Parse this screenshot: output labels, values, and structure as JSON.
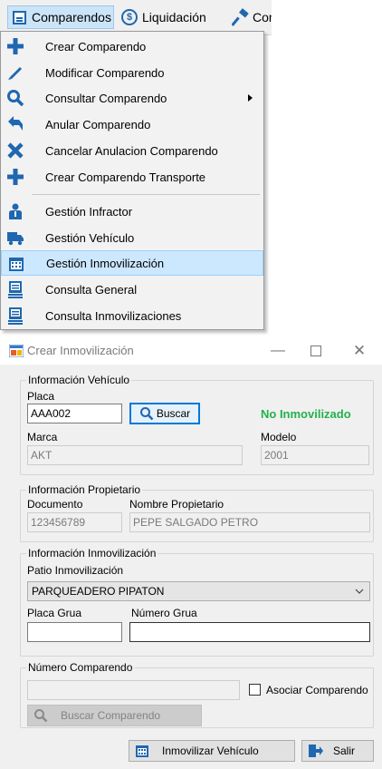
{
  "menubar": {
    "items": [
      {
        "label": "Comparendos",
        "icon": "document-list-icon"
      },
      {
        "label": "Liquidación",
        "icon": "dollar-circle-icon"
      },
      {
        "label": "Con",
        "icon": "gavel-icon"
      }
    ]
  },
  "dropdown": {
    "items": [
      {
        "label": "Crear Comparendo",
        "icon": "plus-icon"
      },
      {
        "label": "Modificar Comparendo",
        "icon": "pencil-icon"
      },
      {
        "label": "Consultar Comparendo",
        "icon": "search-icon",
        "submenu": true
      },
      {
        "label": "Anular Comparendo",
        "icon": "undo-arrow-icon"
      },
      {
        "label": "Cancelar Anulacion Comparendo",
        "icon": "x-icon"
      },
      {
        "label": "Crear Comparendo Transporte",
        "icon": "plus-icon"
      },
      {
        "label": "Gestión Infractor",
        "icon": "person-icon"
      },
      {
        "label": "Gestión Vehículo",
        "icon": "truck-icon"
      },
      {
        "label": "Gestión Inmovilización",
        "icon": "calendar-icon",
        "highlighted": true
      },
      {
        "label": "Consulta General",
        "icon": "stack-icon"
      },
      {
        "label": "Consulta Inmovilizaciones",
        "icon": "stack-icon"
      }
    ]
  },
  "dialog": {
    "title": "Crear Inmovilización",
    "vehiculo": {
      "legend": "Información Vehículo",
      "placa_label": "Placa",
      "placa_value": "AAA002",
      "buscar_label": "Buscar",
      "status": "No Inmovilizado",
      "marca_label": "Marca",
      "marca_value": "AKT",
      "modelo_label": "Modelo",
      "modelo_value": "2001"
    },
    "propietario": {
      "legend": "Información Propietario",
      "documento_label": "Documento",
      "documento_value": "123456789",
      "nombre_label": "Nombre Propietario",
      "nombre_value": "PEPE SALGADO PETRO"
    },
    "inmovilizacion": {
      "legend": "Información Inmovilización",
      "patio_label": "Patio Inmovilización",
      "patio_value": "PARQUEADERO PIPATON",
      "placa_grua_label": "Placa Grua",
      "placa_grua_value": "",
      "numero_grua_label": "Número Grua",
      "numero_grua_value": ""
    },
    "comparendo": {
      "legend": "Número Comparendo",
      "numero_value": "",
      "asociar_label": "Asociar Comparendo",
      "buscar_label": "Buscar Comparendo"
    },
    "footer": {
      "inmovilizar_label": "Inmovilizar Vehículo",
      "salir_label": "Salir"
    }
  },
  "colors": {
    "accent": "#1f67b1",
    "highlight": "#cce8ff",
    "status_green": "#22b14c"
  }
}
